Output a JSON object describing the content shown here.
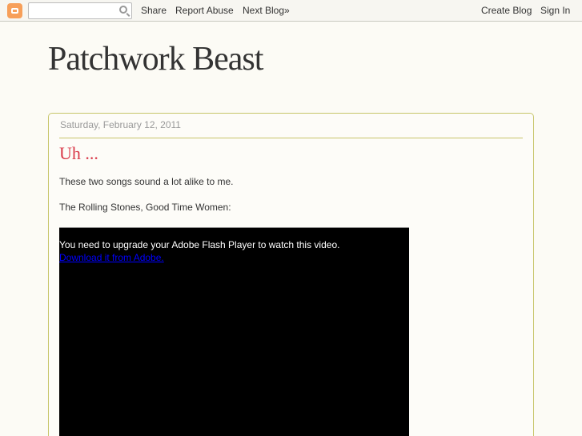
{
  "navbar": {
    "search": {
      "value": "",
      "placeholder": ""
    },
    "links": [
      "Share",
      "Report Abuse",
      "Next Blog»"
    ],
    "right": [
      "Create Blog",
      "Sign In"
    ]
  },
  "blog": {
    "title": "Patchwork Beast"
  },
  "post": {
    "date": "Saturday, February 12, 2011",
    "title": "Uh ...",
    "paragraphs": [
      "These two songs sound a lot alike to me.",
      "The Rolling Stones, Good Time Women:"
    ],
    "video": {
      "message": "You need to upgrade your Adobe Flash Player to watch this video.",
      "link": "Download it from Adobe."
    }
  },
  "colors": {
    "accent": "#d93a4a",
    "border": "#c7c56a"
  }
}
